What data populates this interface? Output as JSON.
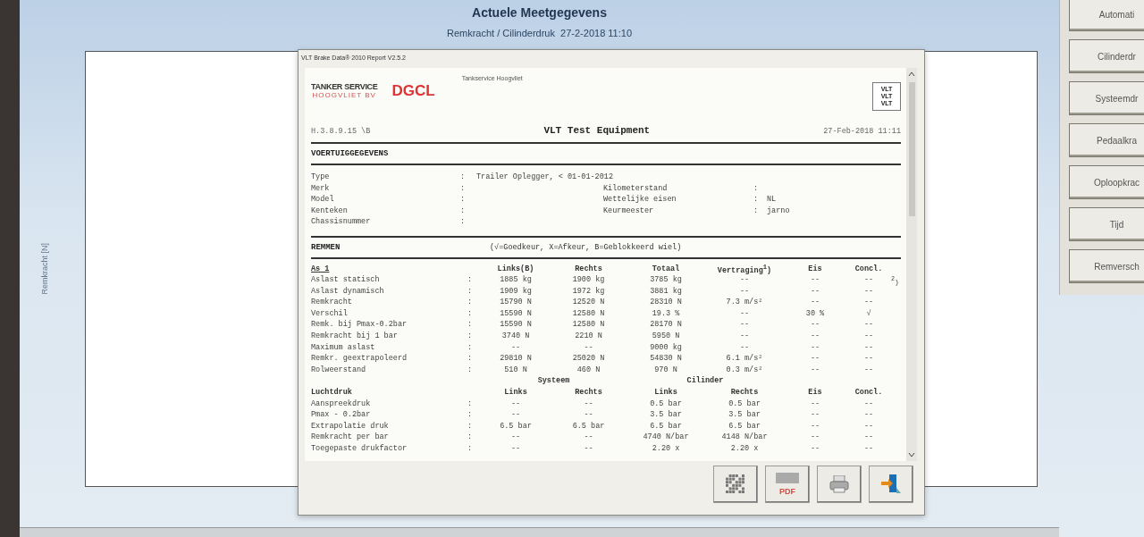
{
  "header": {
    "title": "Actuele Meetgegevens",
    "subtitle": "Remkracht / Cilinderdruk  27-2-2018 11:10"
  },
  "chart_panel": {
    "ylabel": "Remkracht [N]"
  },
  "sidebar": {
    "buttons": [
      {
        "label": "Automati"
      },
      {
        "label": "Cilinderdr"
      },
      {
        "label": "Systeemdr"
      },
      {
        "label": "Pedaalkra"
      },
      {
        "label": "Oploopkrac"
      },
      {
        "label": "Tijd"
      },
      {
        "label": "Remversch"
      }
    ]
  },
  "dialog": {
    "title": "VLT Brake Data® 2010 Report V2.5.2",
    "report": {
      "logos": {
        "tanker": "TANKER SERVICE",
        "tanker_sub": "HOOGVLIET BV",
        "dgcl": "DGCL",
        "vlt": [
          "VLT",
          "VLT",
          "VLT"
        ]
      },
      "company": "Tankservice Hoogvliet",
      "version": "H.3.8.9.15 \\B",
      "heading": "VLT Test Equipment",
      "date": "27-Feb-2018 11:11",
      "vehicle": {
        "title": "VOERTUIGGEGEVENS",
        "left": [
          {
            "label": "Type",
            "sep": ":",
            "value": "Trailer Oplegger, < 01-01-2012"
          },
          {
            "label": "Merk",
            "sep": ":"
          },
          {
            "label": "Model",
            "sep": ":"
          },
          {
            "label": "Kenteken",
            "sep": ":"
          },
          {
            "label": "Chassisnummer",
            "sep": ":"
          }
        ],
        "right": [
          {
            "label": "Kilometerstand",
            "sep": ":"
          },
          {
            "label": "Wettelijke eisen",
            "sep": ":",
            "value": "NL"
          },
          {
            "label": "Keurmeester",
            "sep": ":",
            "value": "jarno"
          }
        ]
      },
      "brakes": {
        "title": "REMMEN",
        "legend": "(√=Goedkeur, X=Afkeur, B=Geblokkeerd wiel)",
        "axle": {
          "label": "As 1",
          "columns": [
            "Links(B)",
            "Rechts",
            "Totaal",
            "Vertraging$^{1}$)",
            "Eis",
            "Concl."
          ],
          "rows": [
            {
              "label": "Aslast statisch",
              "sep": ":",
              "cells": [
                "1885 kg",
                "1900 kg",
                "3785 kg",
                "--",
                "--",
                "--"
              ],
              "note": "$^{2}$)"
            },
            {
              "label": "Aslast dynamisch",
              "sep": ":",
              "cells": [
                "1909 kg",
                "1972 kg",
                "3881 kg",
                "--",
                "--",
                "--"
              ]
            },
            {
              "label": "Remkracht",
              "sep": ":",
              "cells": [
                "15790 N",
                "12520 N",
                "28310 N",
                "7.3 m/s²",
                "--",
                "--"
              ]
            },
            {
              "label": "Verschil",
              "sep": ":",
              "cells": [
                "15590 N",
                "12580 N",
                "19.3 %",
                "--",
                "30 %",
                "√"
              ]
            },
            {
              "label": "Remk. bij Pmax-0.2bar",
              "sep": ":",
              "cells": [
                "15590 N",
                "12580 N",
                "28170 N",
                "--",
                "--",
                "--"
              ]
            },
            {
              "label": "Remkracht bij 1 bar",
              "sep": ":",
              "cells": [
                "3740 N",
                "2210 N",
                "5950 N",
                "--",
                "--",
                "--"
              ]
            },
            {
              "label": "Maximum aslast",
              "sep": ":",
              "cells": [
                "--",
                "--",
                "9000 kg",
                "--",
                "--",
                "--"
              ]
            },
            {
              "label": "Remkr. geextrapoleerd",
              "sep": ":",
              "cells": [
                "29810 N",
                "25020 N",
                "54830 N",
                "6.1 m/s²",
                "--",
                "--"
              ]
            },
            {
              "label": "Rolweerstand",
              "sep": ":",
              "cells": [
                "510 N",
                "460 N",
                "970 N",
                "0.3 m/s²",
                "--",
                "--"
              ]
            }
          ]
        },
        "air": {
          "label": "Luchtdruk",
          "groups": [
            "Systeem",
            "Cilinder"
          ],
          "columns": [
            "Links",
            "Rechts",
            "Links",
            "Rechts",
            "Eis",
            "Concl."
          ],
          "rows": [
            {
              "label": "Aanspreekdruk",
              "sep": ":",
              "cells": [
                "--",
                "--",
                "0.5 bar",
                "0.5 bar",
                "--",
                "--"
              ]
            },
            {
              "label": "Pmax - 0.2bar",
              "sep": ":",
              "cells": [
                "--",
                "--",
                "3.5 bar",
                "3.5 bar",
                "--",
                "--"
              ]
            },
            {
              "label": "Extrapolatie druk",
              "sep": ":",
              "cells": [
                "6.5 bar",
                "6.5 bar",
                "6.5 bar",
                "6.5 bar",
                "--",
                "--"
              ]
            },
            {
              "label": "Remkracht per bar",
              "sep": ":",
              "cells": [
                "--",
                "--",
                "4740 N/bar",
                "4148 N/bar",
                "--",
                "--"
              ]
            },
            {
              "label": "Toegepaste drukfactor",
              "sep": ":",
              "cells": [
                "--",
                "--",
                "2.20 x",
                "2.20 x",
                "--",
                "--"
              ]
            }
          ]
        }
      }
    },
    "buttons": [
      {
        "kind": "barcode"
      },
      {
        "kind": "pdf",
        "label": "PDF"
      },
      {
        "kind": "print"
      },
      {
        "kind": "exit"
      }
    ]
  }
}
